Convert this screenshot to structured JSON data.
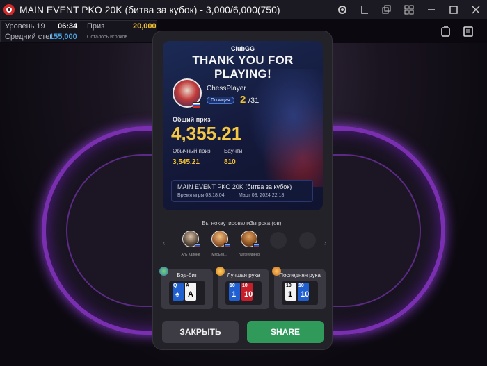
{
  "window": {
    "title": "MAIN EVENT PKO 20K (битва за кубок) - 3,000/6,000(750)",
    "controls": [
      "settings-icon",
      "layout-icon",
      "windows-icon",
      "grid-icon",
      "minimize-icon",
      "maximize-icon",
      "close-icon"
    ]
  },
  "info": {
    "level_label": "Уровень 19",
    "timer": "06:34",
    "prize_label": "Приз",
    "prize_value": "20,000",
    "avg_stack_label": "Средний стек",
    "avg_stack_value": "155,000",
    "remaining_label": "Осталось игроков"
  },
  "result": {
    "brand": "ClubGG",
    "headline": "THANK YOU FOR PLAYING!",
    "player_name": "ChessPlayer",
    "position_label": "Позиция",
    "position": "2",
    "position_total": "/31",
    "total_prize_label": "Общий приз",
    "total_prize": "4,355.21",
    "regular_prize_label": "Обычный приз",
    "regular_prize": "3,545.21",
    "bounty_label": "Баунти",
    "bounty": "810",
    "tournament_name": "MAIN EVENT PKO 20K (битва за кубок)",
    "game_time": "Время игры 03:18:04",
    "game_date": "Март 08, 2024 22:18"
  },
  "knockouts": {
    "text": "Вы нокаутировали3игрока (ов).",
    "players": [
      {
        "name": "Аль Капоне"
      },
      {
        "name": "Мярьев17"
      },
      {
        "name": "hunterwaleep"
      }
    ]
  },
  "hands": [
    {
      "label": "Бэд-бит",
      "cards": [
        [
          "Q",
          "Q"
        ],
        [
          "A",
          "A"
        ]
      ]
    },
    {
      "label": "Лучшая рука",
      "cards": [
        [
          "10",
          "1"
        ],
        [
          "10",
          "10"
        ]
      ]
    },
    {
      "label": "Последняя рука",
      "cards": [
        [
          "10",
          "1"
        ],
        [
          "10",
          "10"
        ]
      ]
    }
  ],
  "buttons": {
    "close": "ЗАКРЫТЬ",
    "share": "SHARE"
  },
  "colors": {
    "accent_gold": "#f5c842",
    "share_green": "#2f9a5a",
    "table_neon": "#8a3bd0"
  }
}
